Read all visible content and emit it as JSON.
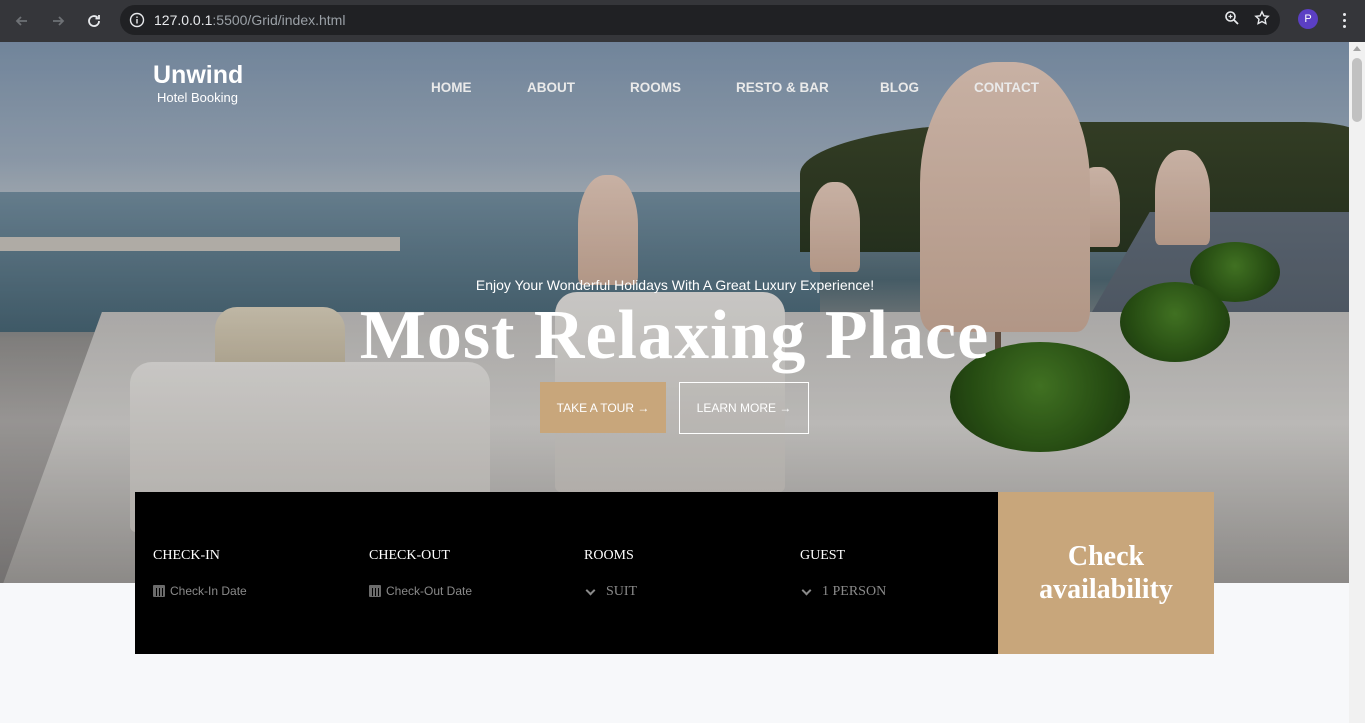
{
  "browser": {
    "url_host": "127.0.0.1",
    "url_rest": ":5500/Grid/index.html",
    "avatar_letter": "P",
    "icons": [
      "back-arrow-icon",
      "forward-arrow-icon",
      "reload-icon",
      "info-icon",
      "zoom-icon",
      "star-icon",
      "kebab-menu-icon"
    ]
  },
  "brand": {
    "name": "Unwind",
    "subtitle": "Hotel Booking"
  },
  "nav": {
    "items": [
      {
        "label": "HOME"
      },
      {
        "label": "ABOUT"
      },
      {
        "label": "ROOMS"
      },
      {
        "label": "RESTO & BAR"
      },
      {
        "label": "BLOG"
      },
      {
        "label": "CONTACT"
      }
    ]
  },
  "hero": {
    "tagline": "Enjoy Your Wonderful Holidays With A Great Luxury Experience!",
    "headline": "Most Relaxing Place",
    "tour_button": "TAKE A TOUR →",
    "learn_button": "LEARN MORE →"
  },
  "booking": {
    "fields": [
      {
        "label": "CHECK-IN",
        "value": "Check-In Date",
        "icon": "calendar-icon"
      },
      {
        "label": "CHECK-OUT",
        "value": "Check-Out Date",
        "icon": "calendar-icon"
      },
      {
        "label": "ROOMS",
        "value": "SUIT",
        "icon": "chevron-down-icon"
      },
      {
        "label": "GUEST",
        "value": "1 PERSON",
        "icon": "chevron-down-icon"
      }
    ],
    "submit": "Check availability"
  },
  "colors": {
    "accent": "#c8a67b",
    "booking_bg": "#000000",
    "page_bg": "#f7f8fa"
  }
}
